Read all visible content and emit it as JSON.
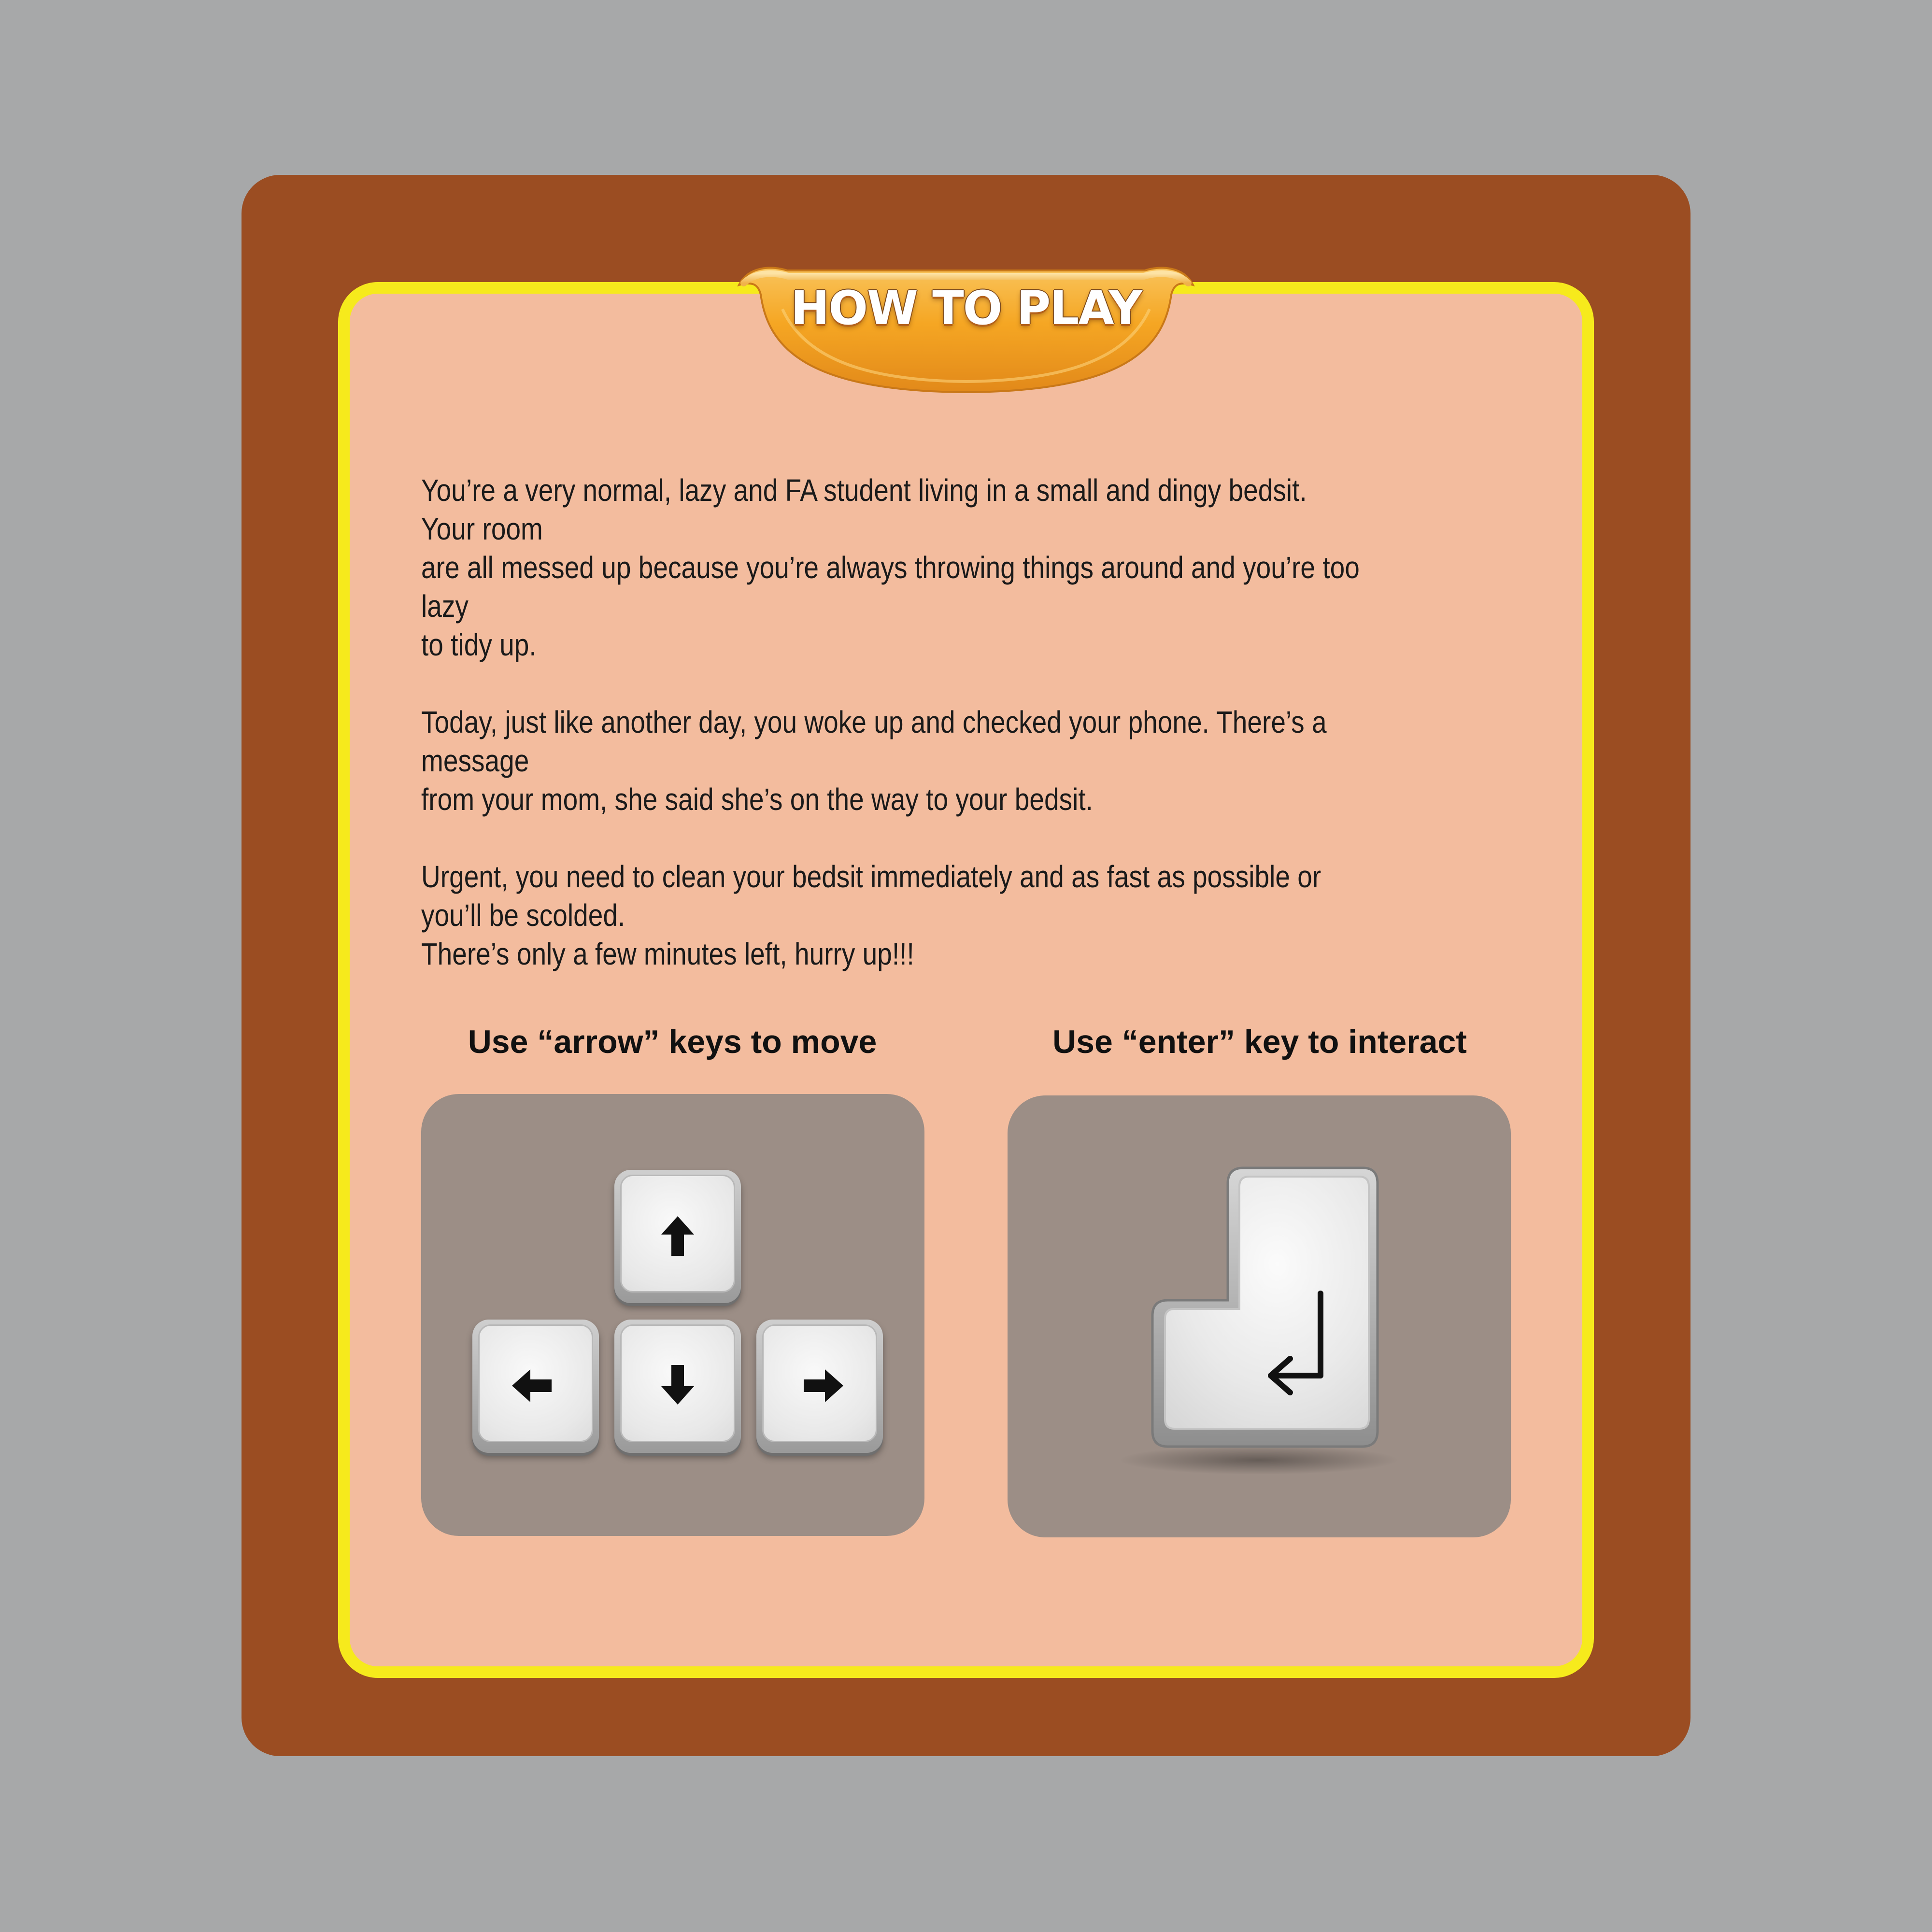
{
  "banner": {
    "title": "HOW TO PLAY"
  },
  "story": {
    "paragraphs": [
      "You’re a very normal, lazy and FA student living in a small and dingy bedsit. Your room\nare all messed up because you’re always throwing things around and you’re too lazy\nto tidy up.",
      "Today, just like another day, you woke up and checked your phone. There’s a message\nfrom your mom, she said she’s on the way to your bedsit.",
      "Urgent, you need to clean your bedsit immediately and as fast as possible or\nyou’ll be scolded.\nThere’s only a few minutes left, hurry up!!!"
    ]
  },
  "controls": {
    "move_label": "Use “arrow” keys to move",
    "interact_label": "Use “enter” key to interact",
    "move_keys": [
      "arrow-up",
      "arrow-left",
      "arrow-down",
      "arrow-right"
    ],
    "interact_key": "enter"
  },
  "colors": {
    "background": "#a7a8a9",
    "frame": "#9b4d22",
    "panel": "#f3bc9e",
    "panel_border": "#f6ea1c",
    "banner": "#f5a623",
    "keybox": "#9c8e86"
  }
}
